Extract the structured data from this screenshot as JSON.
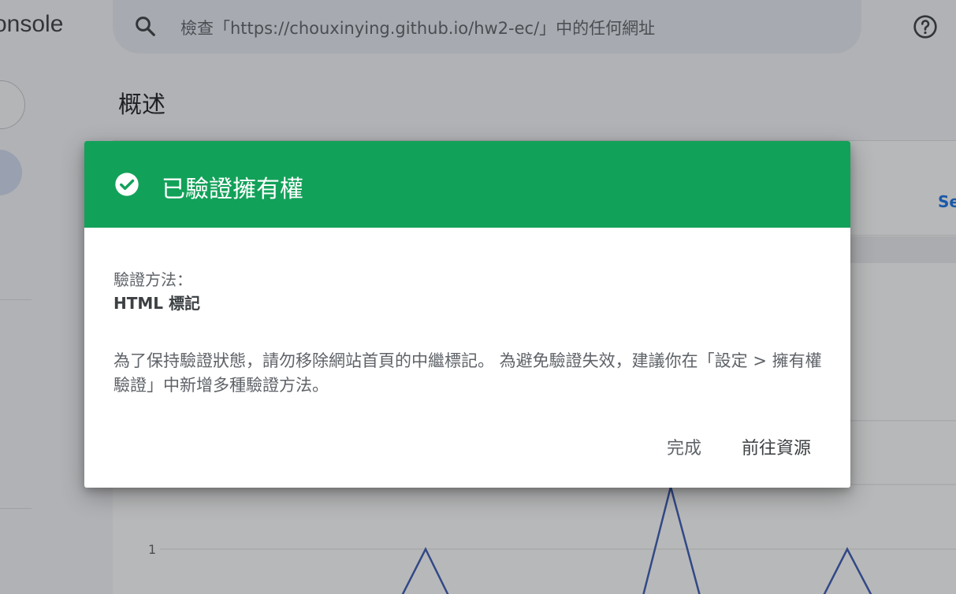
{
  "app": {
    "brand_fragment": "onsole",
    "search": {
      "placeholder": "檢查「https://chouxinying.github.io/hw2-ec/」中的任何網址"
    },
    "page_title": "概述",
    "side_link_fragment": "Se",
    "chart_tick": "1",
    "icons": {
      "search": "search-icon",
      "help": "help-icon"
    }
  },
  "dialog": {
    "title": "已驗證擁有權",
    "icon": "check-circle-icon",
    "header_color": "#12a159",
    "method_label": "驗證方法：",
    "method_value": "HTML 標記",
    "message": "為了保持驗證狀態，請勿移除網站首頁的中繼標記。 為避免驗證失效，建議你在「設定 > 擁有權驗證」中新增多種驗證方法。",
    "buttons": {
      "done": "完成",
      "go_to_property": "前往資源"
    }
  }
}
